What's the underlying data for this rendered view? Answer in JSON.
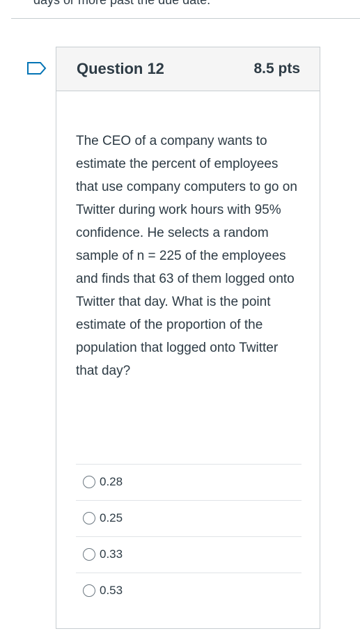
{
  "page": {
    "top_text": "days or more past the due date."
  },
  "question": {
    "title": "Question 12",
    "points": "8.5 pts",
    "flag_icon": "flag-icon",
    "text": "The CEO of a company wants to estimate the percent of employees that use company computers to go on Twitter during work hours with 95% confidence. He selects a random sample of n = 225 of the employees and finds that 63 of them logged onto Twitter that day. What is the point estimate of the proportion of the population that logged onto Twitter that day?"
  },
  "answers": [
    {
      "label": "0.28"
    },
    {
      "label": "0.25"
    },
    {
      "label": "0.33"
    },
    {
      "label": "0.53"
    }
  ],
  "colors": {
    "accent": "#0374b5",
    "text": "#2d3b45",
    "border": "#c7cdd1",
    "header_bg": "#f5f5f5"
  }
}
